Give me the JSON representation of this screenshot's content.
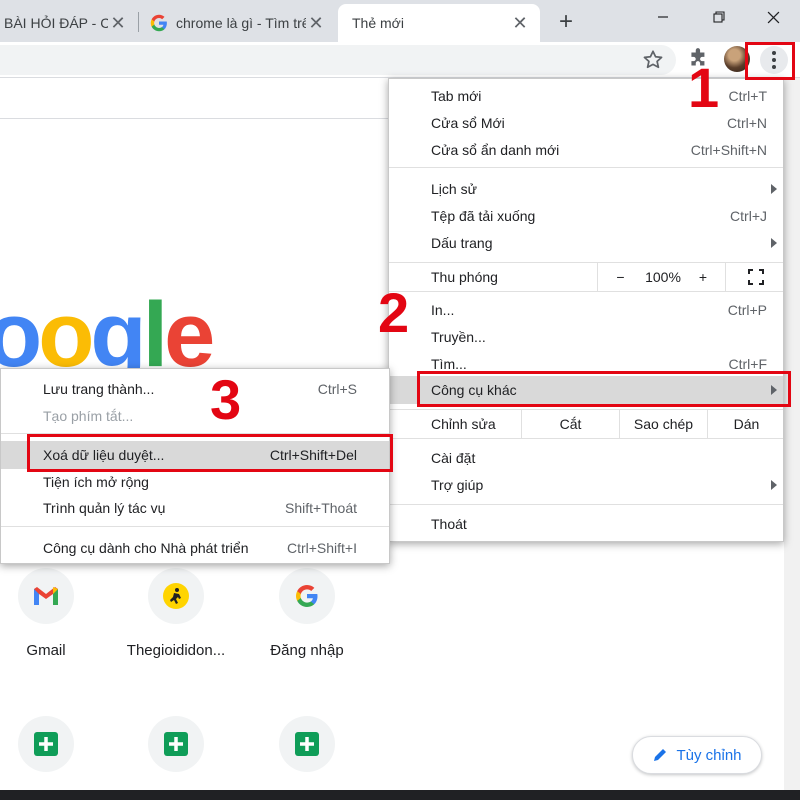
{
  "tabs": [
    {
      "title": "BÀI HỎI ĐÁP - C"
    },
    {
      "title": "chrome là gì - Tìm trê"
    },
    {
      "title": "Thẻ mới"
    }
  ],
  "window": {
    "new_tab_symbol": "+",
    "minimize": "—",
    "maximize": "❐",
    "close": "✕"
  },
  "menu": {
    "items": [
      {
        "label": "Tab mới",
        "shortcut": "Ctrl+T"
      },
      {
        "label": "Cửa sổ Mới",
        "shortcut": "Ctrl+N"
      },
      {
        "label": "Cửa sổ ẩn danh mới",
        "shortcut": "Ctrl+Shift+N"
      },
      {
        "label": "Lịch sử",
        "shortcut": ""
      },
      {
        "label": "Tệp đã tải xuống",
        "shortcut": "Ctrl+J"
      },
      {
        "label": "Dấu trang",
        "shortcut": ""
      },
      {
        "label": "In...",
        "shortcut": "Ctrl+P"
      },
      {
        "label": "Truyền...",
        "shortcut": ""
      },
      {
        "label": "Tìm...",
        "shortcut": "Ctrl+F"
      },
      {
        "label": "Công cụ khác",
        "shortcut": ""
      },
      {
        "label": "Cài đặt",
        "shortcut": ""
      },
      {
        "label": "Trợ giúp",
        "shortcut": ""
      },
      {
        "label": "Thoát",
        "shortcut": ""
      }
    ],
    "zoom": {
      "label": "Thu phóng",
      "minus": "−",
      "value": "100%",
      "plus": "+"
    },
    "edit": {
      "label": "Chỉnh sửa",
      "cut": "Cắt",
      "copy": "Sao chép",
      "paste": "Dán"
    }
  },
  "submenu": {
    "items": [
      {
        "label": "Lưu trang thành...",
        "shortcut": "Ctrl+S"
      },
      {
        "label": "Tạo phím tắt...",
        "shortcut": ""
      },
      {
        "label": "Xoá dữ liệu duyệt...",
        "shortcut": "Ctrl+Shift+Del"
      },
      {
        "label": "Tiện ích mở rộng",
        "shortcut": ""
      },
      {
        "label": "Trình quản lý tác vụ",
        "shortcut": "Shift+Thoát"
      },
      {
        "label": "Công cụ dành cho Nhà phát triển",
        "shortcut": "Ctrl+Shift+I"
      }
    ]
  },
  "shortcuts": [
    {
      "label": "Gmail"
    },
    {
      "label": "Thegioididon..."
    },
    {
      "label": "Đăng nhập"
    }
  ],
  "customize_label": "Tùy chỉnh",
  "logo_text": "oogle",
  "annotations": {
    "step1": "1",
    "step2": "2",
    "step3": "3",
    "color": "#e30613"
  }
}
